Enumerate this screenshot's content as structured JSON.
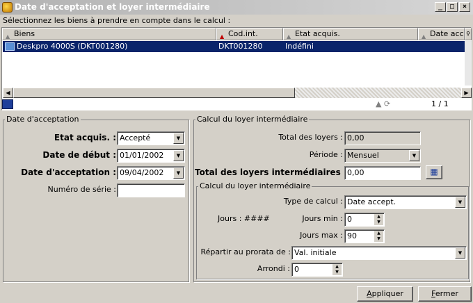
{
  "window": {
    "title": "Date d'acceptation et loyer intermédiaire"
  },
  "instructions": "Sélectionnez les biens à prendre en compte dans le calcul :",
  "list": {
    "columns": [
      "Biens",
      "Cod.int.",
      "Etat acquis.",
      "Date acc"
    ],
    "rows": [
      {
        "biens": "Deskpro 4000S (DKT001280)",
        "cod_int": "DKT001280",
        "etat": "Indéfini",
        "date": ""
      }
    ],
    "pager": "1 / 1"
  },
  "acceptance": {
    "group_label": "Date d'acceptation",
    "etat_label": "Etat acquis. :",
    "etat_value": "Accepté",
    "debut_label": "Date de début :",
    "debut_value": "01/01/2002",
    "accept_label": "Date d'acceptation :",
    "accept_value": "09/04/2002",
    "serial_label": "Numéro de série :",
    "serial_value": ""
  },
  "calcul": {
    "group_label": "Calcul du loyer intermédiaire",
    "total_label": "Total des loyers :",
    "total_value": "0,00",
    "periode_label": "Période :",
    "periode_value": "Mensuel",
    "total_inter_label": "Total des loyers intermédiaires :",
    "total_inter_value": "0,00",
    "sub": {
      "group_label": "Calcul du loyer intermédiaire",
      "type_label": "Type de calcul :",
      "type_value": "Date accept.",
      "jours_label": "Jours : ####",
      "jours_min_label": "Jours min :",
      "jours_min_value": "0",
      "jours_max_label": "Jours max :",
      "jours_max_value": "90",
      "prorata_label": "Répartir au prorata de :",
      "prorata_value": "Val. initiale",
      "arrondi_label": "Arrondi :",
      "arrondi_value": "0"
    }
  },
  "buttons": {
    "apply_first": "A",
    "apply_rest": "ppliquer",
    "close_first": "F",
    "close_rest": "ermer"
  }
}
